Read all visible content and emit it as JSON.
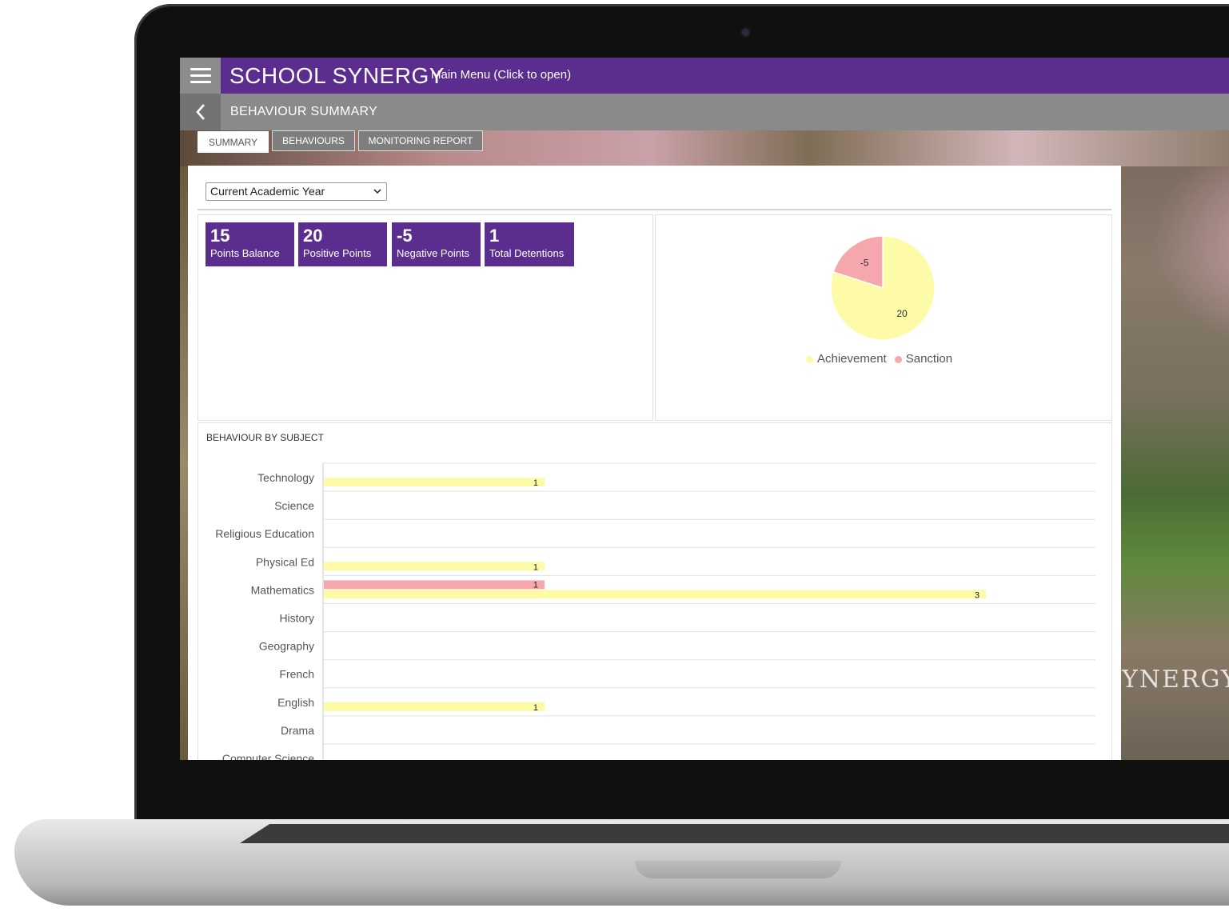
{
  "app": {
    "brand": "SCHOOL SYNERGY",
    "main_menu": "Main Menu (Click to open)",
    "page_title": "BEHAVIOUR SUMMARY",
    "background_text": "YNERGY"
  },
  "tabs": [
    {
      "label": "SUMMARY",
      "active": true
    },
    {
      "label": "BEHAVIOURS",
      "active": false
    },
    {
      "label": "MONITORING REPORT",
      "active": false
    }
  ],
  "filter": {
    "selected": "Current Academic Year"
  },
  "stats": [
    {
      "value": "15",
      "label": "Points Balance"
    },
    {
      "value": "20",
      "label": "Positive Points"
    },
    {
      "value": "-5",
      "label": "Negative Points"
    },
    {
      "value": "1",
      "label": "Total Detentions"
    }
  ],
  "colors": {
    "brand_purple": "#5a2d8e",
    "achievement": "#fdfaa8",
    "sanction": "#f6a7ae"
  },
  "pie_legend": {
    "achievement": "Achievement",
    "sanction": "Sanction"
  },
  "bars_title": "BEHAVIOUR BY SUBJECT",
  "chart_data": [
    {
      "type": "pie",
      "labels": [
        "Achievement",
        "Sanction"
      ],
      "values": [
        20,
        -5
      ],
      "data_labels": [
        "20",
        "-5"
      ]
    },
    {
      "type": "bar",
      "orientation": "horizontal",
      "categories": [
        "Technology",
        "Science",
        "Religious Education",
        "Physical Ed",
        "Mathematics",
        "History",
        "Geography",
        "French",
        "English",
        "Drama",
        "Computer Science"
      ],
      "series": [
        {
          "name": "Sanction",
          "values": [
            0,
            0,
            0,
            0,
            1,
            0,
            0,
            0,
            0,
            0,
            0
          ]
        },
        {
          "name": "Achievement",
          "values": [
            1,
            0,
            0,
            1,
            3,
            0,
            0,
            0,
            1,
            0,
            0
          ]
        }
      ],
      "xlim": [
        0,
        3.5
      ],
      "grid": true
    }
  ]
}
